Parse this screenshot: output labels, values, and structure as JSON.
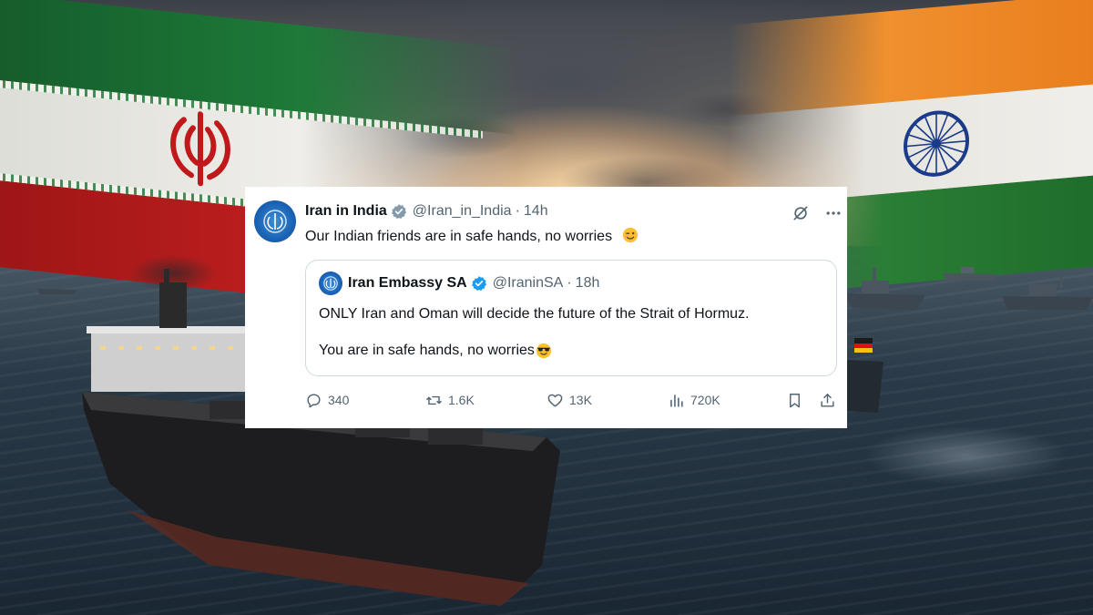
{
  "tweet": {
    "author_name": "Iran in India",
    "author_handle": "@Iran_in_India",
    "separator": "·",
    "time": "14h",
    "text": "Our Indian friends are in safe hands, no worries"
  },
  "quoted": {
    "author_name": "Iran Embassy SA",
    "author_handle": "@IraninSA",
    "separator": "·",
    "time": "18h",
    "line1": "ONLY Iran and Oman will decide the future of the Strait of Hormuz.",
    "line2": "You are in safe hands, no worries"
  },
  "actions": {
    "replies": "340",
    "reposts": "1.6K",
    "likes": "13K",
    "views": "720K"
  },
  "icons": {
    "verified": "verified-badge-icon",
    "grok": "grok-icon",
    "more": "more-icon",
    "reply": "reply-icon",
    "repost": "repost-icon",
    "like": "like-icon",
    "views": "views-icon",
    "bookmark": "bookmark-icon",
    "share": "share-icon",
    "wink": "wink-emoji",
    "sunglasses": "sunglasses-emoji"
  },
  "colors": {
    "verified": "#1d9bf0",
    "text_primary": "#0f1419",
    "text_secondary": "#536471",
    "border": "#cfd9de"
  }
}
